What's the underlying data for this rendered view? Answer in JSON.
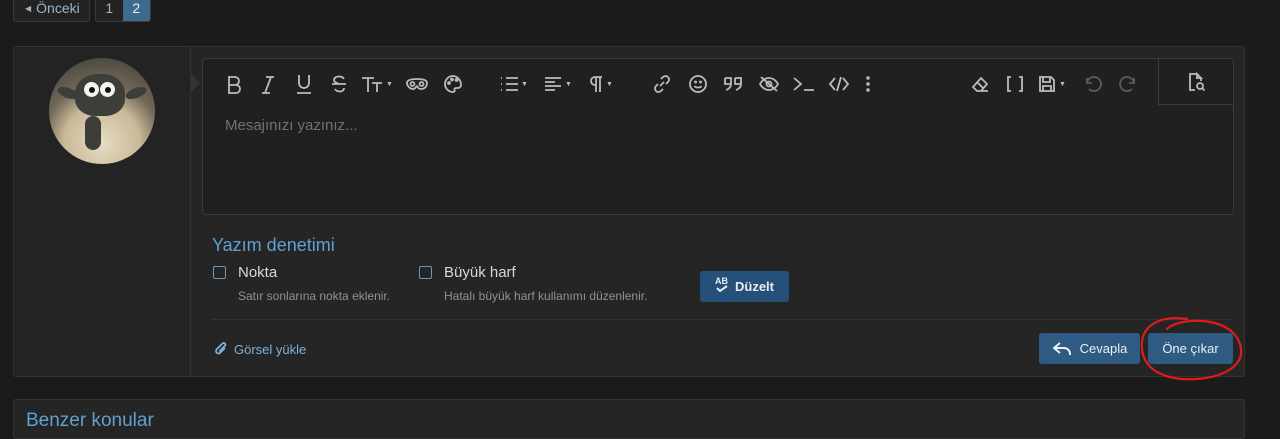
{
  "pagination": {
    "prev_label": "Önceki",
    "pages": [
      "1",
      "2"
    ],
    "current_page": "2"
  },
  "editor": {
    "placeholder": "Mesajınızı yazınız...",
    "toolbar_icons": [
      "bold-icon",
      "italic-icon",
      "underline-icon",
      "strikethrough-icon",
      "text-size-icon",
      "spoiler-icon",
      "color-palette-icon",
      "list-icon",
      "align-icon",
      "paragraph-icon",
      "link-icon",
      "smiley-icon",
      "quote-icon",
      "hide-icon",
      "code-inline-icon",
      "code-icon",
      "more-icon",
      "eraser-icon",
      "bbcode-toggle-icon",
      "drafts-icon",
      "undo-icon",
      "redo-icon",
      "preview-icon"
    ]
  },
  "spellcheck": {
    "title": "Yazım denetimi",
    "options": [
      {
        "label": "Nokta",
        "hint": "Satır sonlarına nokta eklenir.",
        "checked": false
      },
      {
        "label": "Büyük harf",
        "hint": "Hatalı büyük harf kullanımı düzenlenir.",
        "checked": false
      }
    ],
    "fix_button": "Düzelt",
    "fix_icon_text": "AB"
  },
  "footer": {
    "upload_label": "Görsel yükle",
    "reply_label": "Cevapla",
    "feature_label": "Öne çıkar"
  },
  "next_section": {
    "title": "Benzer konular"
  },
  "colors": {
    "accent": "#2f5b82",
    "link": "#5fa0cf",
    "annotation": "#e01b1b"
  }
}
